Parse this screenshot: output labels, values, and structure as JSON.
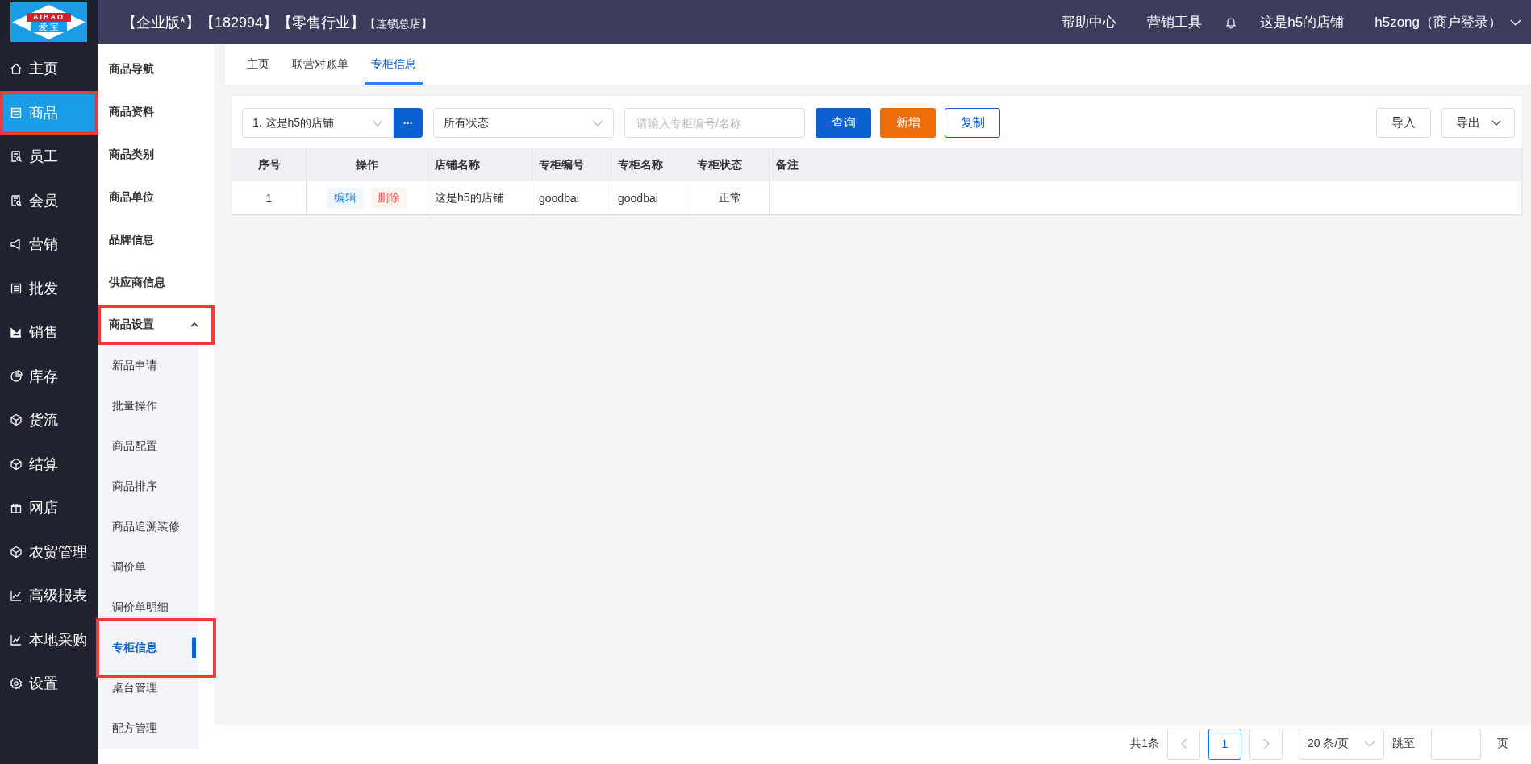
{
  "logo": {
    "top": "AIBAO",
    "bottom": "爱 宝"
  },
  "header": {
    "title": "【企业版*】【182994】【零售行业】",
    "subtitle": "【连锁总店】",
    "links": [
      "帮助中心",
      "营销工具"
    ],
    "store": "这是h5的店铺",
    "user": "h5zong（商户登录）"
  },
  "nav": [
    {
      "label": "主页",
      "kind": "home",
      "selected": false,
      "highlighted": false
    },
    {
      "label": "商品",
      "kind": "shop",
      "selected": true,
      "highlighted": true
    },
    {
      "label": "员工",
      "kind": "doc",
      "selected": false,
      "highlighted": false
    },
    {
      "label": "会员",
      "kind": "doc",
      "selected": false,
      "highlighted": false
    },
    {
      "label": "营销",
      "kind": "horn",
      "selected": false,
      "highlighted": false
    },
    {
      "label": "批发",
      "kind": "list",
      "selected": false,
      "highlighted": false
    },
    {
      "label": "销售",
      "kind": "area",
      "selected": false,
      "highlighted": false
    },
    {
      "label": "库存",
      "kind": "pie",
      "selected": false,
      "highlighted": false
    },
    {
      "label": "货流",
      "kind": "cube",
      "selected": false,
      "highlighted": false
    },
    {
      "label": "结算",
      "kind": "cube",
      "selected": false,
      "highlighted": false
    },
    {
      "label": "网店",
      "kind": "gift",
      "selected": false,
      "highlighted": false
    },
    {
      "label": "农贸管理",
      "kind": "cube",
      "selected": false,
      "highlighted": false
    },
    {
      "label": "高级报表",
      "kind": "line",
      "selected": false,
      "highlighted": false
    },
    {
      "label": "本地采购",
      "kind": "line",
      "selected": false,
      "highlighted": false
    },
    {
      "label": "设置",
      "kind": "gear",
      "selected": false,
      "highlighted": false
    }
  ],
  "submenu": [
    {
      "label": "商品导航",
      "selected": false,
      "highlighted": false
    },
    {
      "label": "商品资料",
      "selected": false,
      "highlighted": false
    },
    {
      "label": "商品类别",
      "selected": false,
      "highlighted": false
    },
    {
      "label": "商品单位",
      "selected": false,
      "highlighted": false
    },
    {
      "label": "品牌信息",
      "selected": false,
      "highlighted": false
    },
    {
      "label": "供应商信息",
      "selected": false,
      "highlighted": false
    },
    {
      "label": "商品设置",
      "selected": false,
      "highlighted": true,
      "expanded": true,
      "children": [
        {
          "label": "新品申请",
          "selected": false,
          "highlighted": false
        },
        {
          "label": "批量操作",
          "selected": false,
          "highlighted": false
        },
        {
          "label": "商品配置",
          "selected": false,
          "highlighted": false
        },
        {
          "label": "商品排序",
          "selected": false,
          "highlighted": false
        },
        {
          "label": "商品追溯装修",
          "selected": false,
          "highlighted": false
        },
        {
          "label": "调价单",
          "selected": false,
          "highlighted": false
        },
        {
          "label": "调价单明细",
          "selected": false,
          "highlighted": false
        },
        {
          "label": "专柜信息",
          "selected": true,
          "highlighted": true
        },
        {
          "label": "桌台管理",
          "selected": false,
          "highlighted": false
        },
        {
          "label": "配方管理",
          "selected": false,
          "highlighted": false
        }
      ]
    }
  ],
  "tabs": [
    {
      "label": "主页",
      "selected": false
    },
    {
      "label": "联营对账单",
      "selected": false
    },
    {
      "label": "专柜信息",
      "selected": true
    }
  ],
  "toolbar": {
    "store_select": "1. 这是h5的店铺",
    "more": "···",
    "status_select": "所有状态",
    "search": {
      "placeholder": "请输入专柜编号/名称"
    },
    "query": "查询",
    "add": "新增",
    "copy": "复制",
    "import": "导入",
    "export": "导出"
  },
  "table": {
    "columns": [
      "序号",
      "操作",
      "店铺名称",
      "专柜编号",
      "专柜名称",
      "专柜状态",
      "备注"
    ],
    "rows": [
      {
        "index": "1",
        "edit": "编辑",
        "delete": "删除",
        "store": "这是h5的店铺",
        "code": "goodbai",
        "name": "goodbai",
        "status": "正常"
      }
    ]
  },
  "pagination": {
    "total": "共1条",
    "page": "1",
    "size": "20 条/页",
    "jump": "跳至",
    "page_unit": "页"
  }
}
